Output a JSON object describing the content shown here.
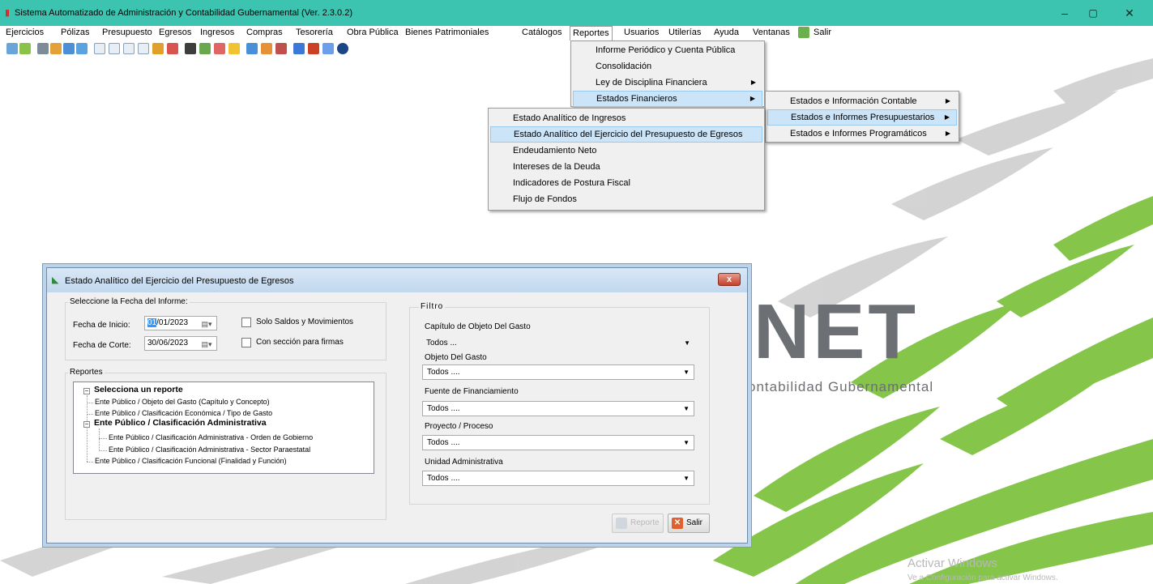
{
  "window": {
    "title": "Sistema Automatizado de Administración y Contabilidad Gubernamental  (Ver. 2.3.0.2)",
    "minimize_icon": "minimize-icon",
    "maximize_icon": "maximize-icon",
    "close_icon": "close-icon",
    "minimize": "–",
    "maximize": "▢",
    "close": "✕"
  },
  "menubar": {
    "items": [
      "Ejercicios",
      "Pólizas",
      "Presupuesto",
      "Egresos",
      "Ingresos",
      "Compras",
      "Tesorería",
      "Obra Pública",
      "Bienes Patrimoniales",
      "Catálogos",
      "Reportes",
      "Usuarios",
      "Utilerías",
      "Ayuda",
      "Ventanas",
      "Salir"
    ],
    "active": "Reportes"
  },
  "reportes_menu": {
    "items": [
      "Informe Periódico y Cuenta Pública",
      "Consolidación",
      "Ley de Disciplina Financiera",
      "Estados Financieros"
    ],
    "highlighted": "Estados Financieros"
  },
  "estados_menu": {
    "items": [
      "Estados e Información Contable",
      "Estados e Informes Presupuestarios",
      "Estados e Informes Programáticos"
    ],
    "highlighted": "Estados e Informes Presupuestarios"
  },
  "presupuestarios_menu": {
    "items": [
      "Estado Analítico de Ingresos",
      "Estado Analítico del Ejercicio del Presupuesto de Egresos",
      "Endeudamiento Neto",
      "Intereses de la Deuda",
      "Indicadores de Postura Fiscal",
      "Flujo de Fondos"
    ],
    "highlighted": "Estado Analítico del Ejercicio del Presupuesto de Egresos"
  },
  "dialog": {
    "title": "Estado Analítico del Ejercicio del Presupuesto de Egresos",
    "close": "x",
    "fecha_group": "Seleccione la Fecha del Informe:",
    "fecha_inicio_label": "Fecha de Inicio:",
    "fecha_inicio_sel": "01",
    "fecha_inicio_rest": "/01/2023",
    "fecha_corte_label": "Fecha de Corte:",
    "fecha_corte": "30/06/2023",
    "chk_saldos": "Solo Saldos y Movimientos",
    "chk_firmas": "Con sección para firmas",
    "reportes_group": "Reportes",
    "tree": {
      "root": "Selecciona un reporte",
      "n1": "Ente Público / Objeto del Gasto (Capítulo y Concepto)",
      "n2": "Ente Público / Clasificación Económica / Tipo de Gasto",
      "n3": "Ente Público / Clasificación Administrativa",
      "n3a": "Ente Público / Clasificación Administrativa - Orden de Gobierno",
      "n3b": "Ente Público / Clasificación Administrativa - Sector Paraestatal",
      "n4": "Ente Público / Clasificación Funcional (Finalidad y Función)"
    },
    "filtro_group": "Filtro",
    "capitulo_label": "Capítulo de Objeto Del Gasto",
    "capitulo_value": "Todos ...",
    "objeto_label": "Objeto Del Gasto",
    "objeto_value": "Todos ....",
    "fuente_label": "Fuente de Financiamiento",
    "fuente_value": "Todos ....",
    "proyecto_label": "Proyecto / Proceso",
    "proyecto_value": "Todos ....",
    "unidad_label": "Unidad Administrativa",
    "unidad_value": "Todos ....",
    "reporte_button": "Reporte",
    "salir_button": "Salir"
  },
  "background": {
    "brand": "NET",
    "brand_sub": "ontabilidad Gubernamental",
    "watermark": "Activar Windows",
    "watermark_sub": "Ve a Configuración para activar Windows."
  },
  "colors": {
    "titlebar": "#3cc4b0",
    "menu_highlight": "#cce4f7",
    "stripe_green": "#7fc241"
  }
}
